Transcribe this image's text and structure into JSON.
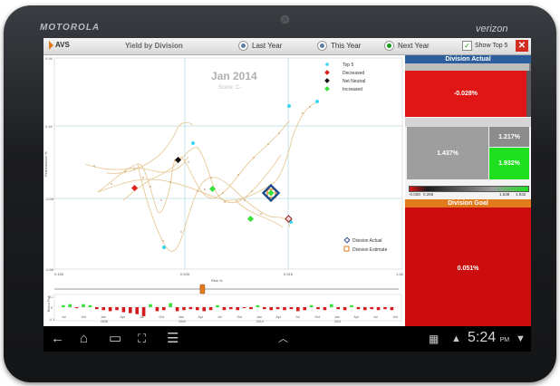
{
  "device": {
    "brand": "MOTOROLA",
    "carrier": "verizon"
  },
  "app": {
    "name": "AVS",
    "title": "Yield by Division"
  },
  "options": {
    "last_year": "Last Year",
    "this_year": "This Year",
    "next_year": "Next Year",
    "show_top5": "Show Top 5",
    "selected": "Next Year"
  },
  "chart": {
    "period": "Jan 2014",
    "score": "Score: C-",
    "xlabel": "Risk %",
    "ylabel": "Performance %",
    "x_ticks": [
      "0.155",
      "0.535",
      "0.915",
      "1.28"
    ],
    "y_ticks": [
      "0.94",
      "0.44",
      "-0.06",
      "-0.56"
    ],
    "legend": [
      {
        "label": "Top 5",
        "color": "#38d8f0",
        "shape": "dot"
      },
      {
        "label": "Decreased",
        "color": "#e02222",
        "shape": "diamond"
      },
      {
        "label": "Net Neutral",
        "color": "#111111",
        "shape": "diamond"
      },
      {
        "label": "Increased",
        "color": "#39e03a",
        "shape": "diamond"
      }
    ],
    "bottom_legend": [
      {
        "label": "Division Actual",
        "color": "#2b4a8a",
        "shape": "diamond-outline"
      },
      {
        "label": "Division Estimate",
        "color": "#e07a1d",
        "shape": "square-outline"
      }
    ]
  },
  "timeline": {
    "ylabel": "Bench Perf",
    "y_ticks": [
      "0.1",
      "0",
      "-0.1"
    ],
    "month_labels": [
      "Jul",
      "Oct",
      "Jan",
      "Apr",
      "Jul",
      "Oct",
      "Jan",
      "Apr",
      "Jul",
      "Oct",
      "Jan",
      "Apr",
      "Jul",
      "Oct",
      "Jan",
      "Apr",
      "Jul",
      "Oct"
    ],
    "year_labels": [
      "2008",
      "2009",
      "2010",
      "2011"
    ],
    "slider_value": 0.43
  },
  "panel": {
    "actual_title": "Division Actual",
    "actual_values": [
      "-0.028%",
      "1.437%",
      "1.217%",
      "1.932%"
    ],
    "scale_labels": [
      "-0.028",
      "0.266",
      "1.638",
      "1.932"
    ],
    "goal_title": "Division Goal",
    "goal_value": "0.051%"
  },
  "status": {
    "time": "5:24",
    "ampm": "PM"
  }
}
